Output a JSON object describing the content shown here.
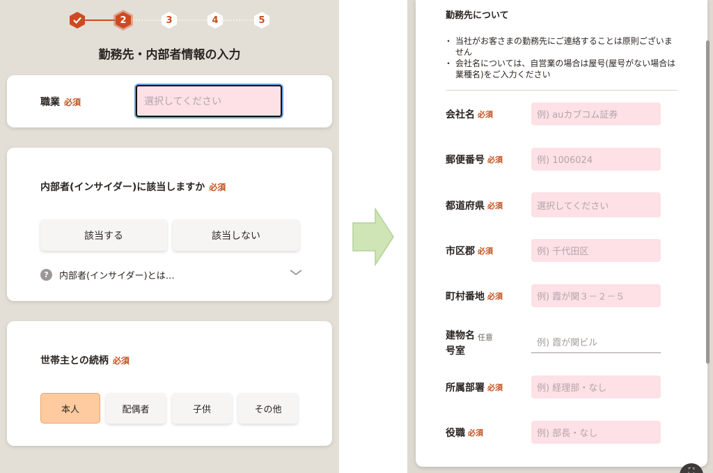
{
  "stepper": {
    "steps": [
      "",
      "2",
      "3",
      "4",
      "5"
    ],
    "done_icon": "checkmark-icon"
  },
  "page_title": "勤務先・内部者情報の入力",
  "occupation": {
    "label": "職業",
    "required": "必須",
    "placeholder": "選択してください"
  },
  "insider": {
    "question": "内部者(インサイダー)に該当しますか",
    "required": "必須",
    "yes_label": "該当する",
    "no_label": "該当しない",
    "help_text": "内部者(インサイダー)とは…",
    "help_icon": "?"
  },
  "relationship": {
    "label": "世帯主との続柄",
    "required": "必須",
    "options": [
      "本人",
      "配偶者",
      "子供",
      "その他"
    ],
    "selected": "本人"
  },
  "employer": {
    "title": "勤務先について",
    "notes": [
      "当社がお客さまの勤務先にご連絡することは原則ございません",
      "会社名については、自営業の場合は屋号(屋号がない場合は業種名)をご入力ください"
    ],
    "fields": [
      {
        "label": "会社名",
        "tag": "必須",
        "placeholder": "例) auカブコム証券"
      },
      {
        "label": "郵便番号",
        "tag": "必須",
        "placeholder": "例) 1006024"
      },
      {
        "label": "都道府県",
        "tag": "必須",
        "placeholder": "選択してください"
      },
      {
        "label": "市区郡",
        "tag": "必須",
        "placeholder": "例) 千代田区"
      },
      {
        "label": "町村番地",
        "tag": "必須",
        "placeholder": "例) 霞が関３－２－５"
      },
      {
        "label": "建物名",
        "label2": "号室",
        "tag": "任意",
        "placeholder": "例) 霞が関ビル"
      },
      {
        "label": "所属部署",
        "tag": "必須",
        "placeholder": "例) 経理部・なし"
      },
      {
        "label": "役職",
        "tag": "必須",
        "placeholder": "例) 部長・なし"
      }
    ]
  },
  "colors": {
    "accent": "#cc4a22",
    "required_text": "#c0531f",
    "input_pink": "#fde1e6",
    "selected_option": "#fdcb9f",
    "left_background": "#e3dfd6",
    "arrow_green": "#cfe5b5"
  },
  "icons": {
    "arrow": "right-arrow-icon",
    "chevron": "chevron-down-icon",
    "fullscreen": "fullscreen-icon"
  }
}
